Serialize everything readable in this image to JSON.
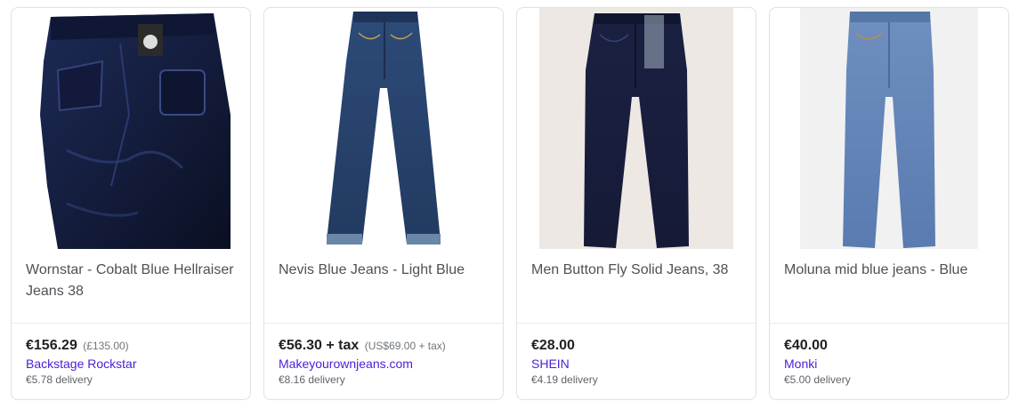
{
  "products": [
    {
      "title": "Wornstar - Cobalt Blue Hellraiser Jeans 38",
      "price": "€156.29",
      "original_price": "(£135.00)",
      "merchant": "Backstage Rockstar",
      "delivery": "€5.78 delivery",
      "image": "jeans-back-photo"
    },
    {
      "title": "Nevis Blue Jeans - Light Blue",
      "price": "€56.30 + tax",
      "original_price": "(US$69.00 + tax)",
      "merchant": "Makeyourownjeans.com",
      "delivery": "€8.16 delivery",
      "image": "jeans-front-photo"
    },
    {
      "title": "Men Button Fly Solid Jeans, 38",
      "price": "€28.00",
      "original_price": "",
      "merchant": "SHEIN",
      "delivery": "€4.19 delivery",
      "image": "jeans-front-photo"
    },
    {
      "title": "Moluna mid blue jeans - Blue",
      "price": "€40.00",
      "original_price": "",
      "merchant": "Monki",
      "delivery": "€5.00 delivery",
      "image": "jeans-front-photo"
    }
  ],
  "colors": {
    "merchant_link": "#4a1fd5",
    "title_text": "#4d5156",
    "card_border": "#dfe1e5"
  }
}
